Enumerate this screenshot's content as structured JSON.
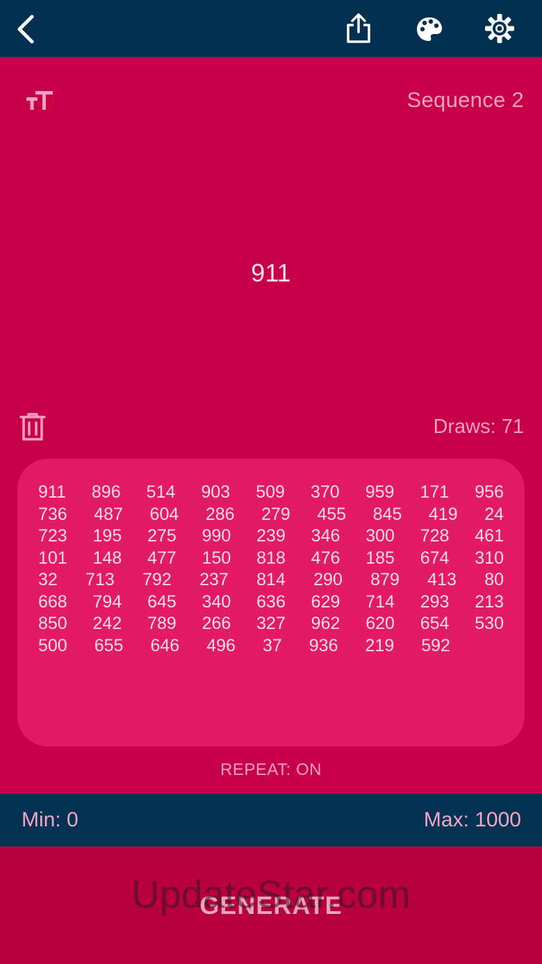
{
  "header": {
    "back_icon": "chevron-left-icon",
    "share_icon": "share-icon",
    "theme_icon": "palette-icon",
    "settings_icon": "gear-icon"
  },
  "sequence": {
    "title": "Sequence 2",
    "current": "911",
    "draws_label": "Draws: 71",
    "repeat_label": "REPEAT: ON"
  },
  "history": {
    "rows": [
      [
        "911",
        "896",
        "514",
        "903",
        "509",
        "370",
        "959",
        "171",
        "956"
      ],
      [
        "736",
        "487",
        "604",
        "286",
        "279",
        "455",
        "845",
        "419",
        "24"
      ],
      [
        "723",
        "195",
        "275",
        "990",
        "239",
        "346",
        "300",
        "728",
        "461"
      ],
      [
        "101",
        "148",
        "477",
        "150",
        "818",
        "476",
        "185",
        "674",
        "310"
      ],
      [
        "32",
        "713",
        "792",
        "237",
        "814",
        "290",
        "879",
        "413",
        "80"
      ],
      [
        "668",
        "794",
        "645",
        "340",
        "636",
        "629",
        "714",
        "293",
        "213"
      ],
      [
        "850",
        "242",
        "789",
        "266",
        "327",
        "962",
        "620",
        "654",
        "530"
      ],
      [
        "500",
        "655",
        "646",
        "496",
        "37",
        "936",
        "219",
        "592"
      ]
    ]
  },
  "range": {
    "min_label": "Min: 0",
    "max_label": "Max: 1000"
  },
  "actions": {
    "generate_label": "GENERATE"
  },
  "watermark": "UpdateStar.com",
  "colors": {
    "header_bg": "#033050",
    "main_bg": "#c8004a",
    "history_bg": "#e31a65",
    "generate_bg": "#b9003e"
  }
}
